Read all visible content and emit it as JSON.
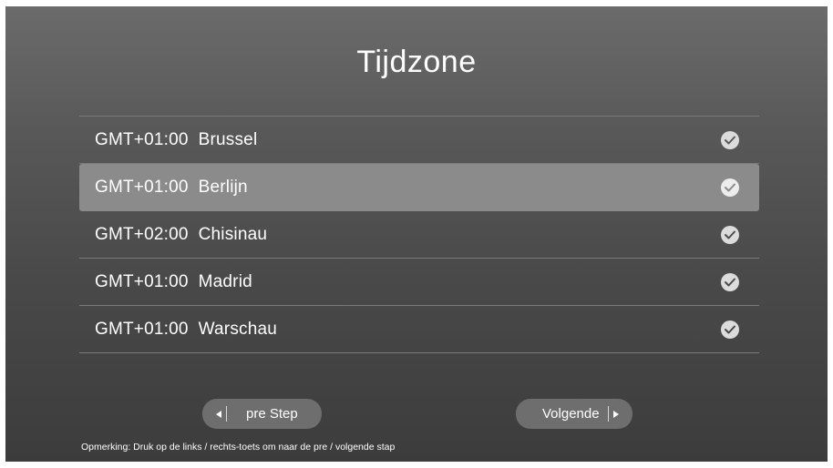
{
  "title": "Tijdzone",
  "timezones": [
    {
      "label": "GMT+01:00  Brussel",
      "selected": false
    },
    {
      "label": "GMT+01:00  Berlijn",
      "selected": true
    },
    {
      "label": "GMT+02:00  Chisinau",
      "selected": false
    },
    {
      "label": "GMT+01:00  Madrid",
      "selected": false
    },
    {
      "label": "GMT+01:00  Warschau",
      "selected": false
    }
  ],
  "buttons": {
    "prev_label": "pre Step",
    "next_label": "Volgende"
  },
  "note": "Opmerking: Druk op de links / rechts-toets om naar de pre / volgende stap",
  "colors": {
    "selected_row": "#8b8b8b",
    "button_bg": "#6e6e6e",
    "text": "#ffffff"
  },
  "icons": {
    "check": "check-circle-icon",
    "left": "triangle-left-icon",
    "right": "triangle-right-icon"
  }
}
